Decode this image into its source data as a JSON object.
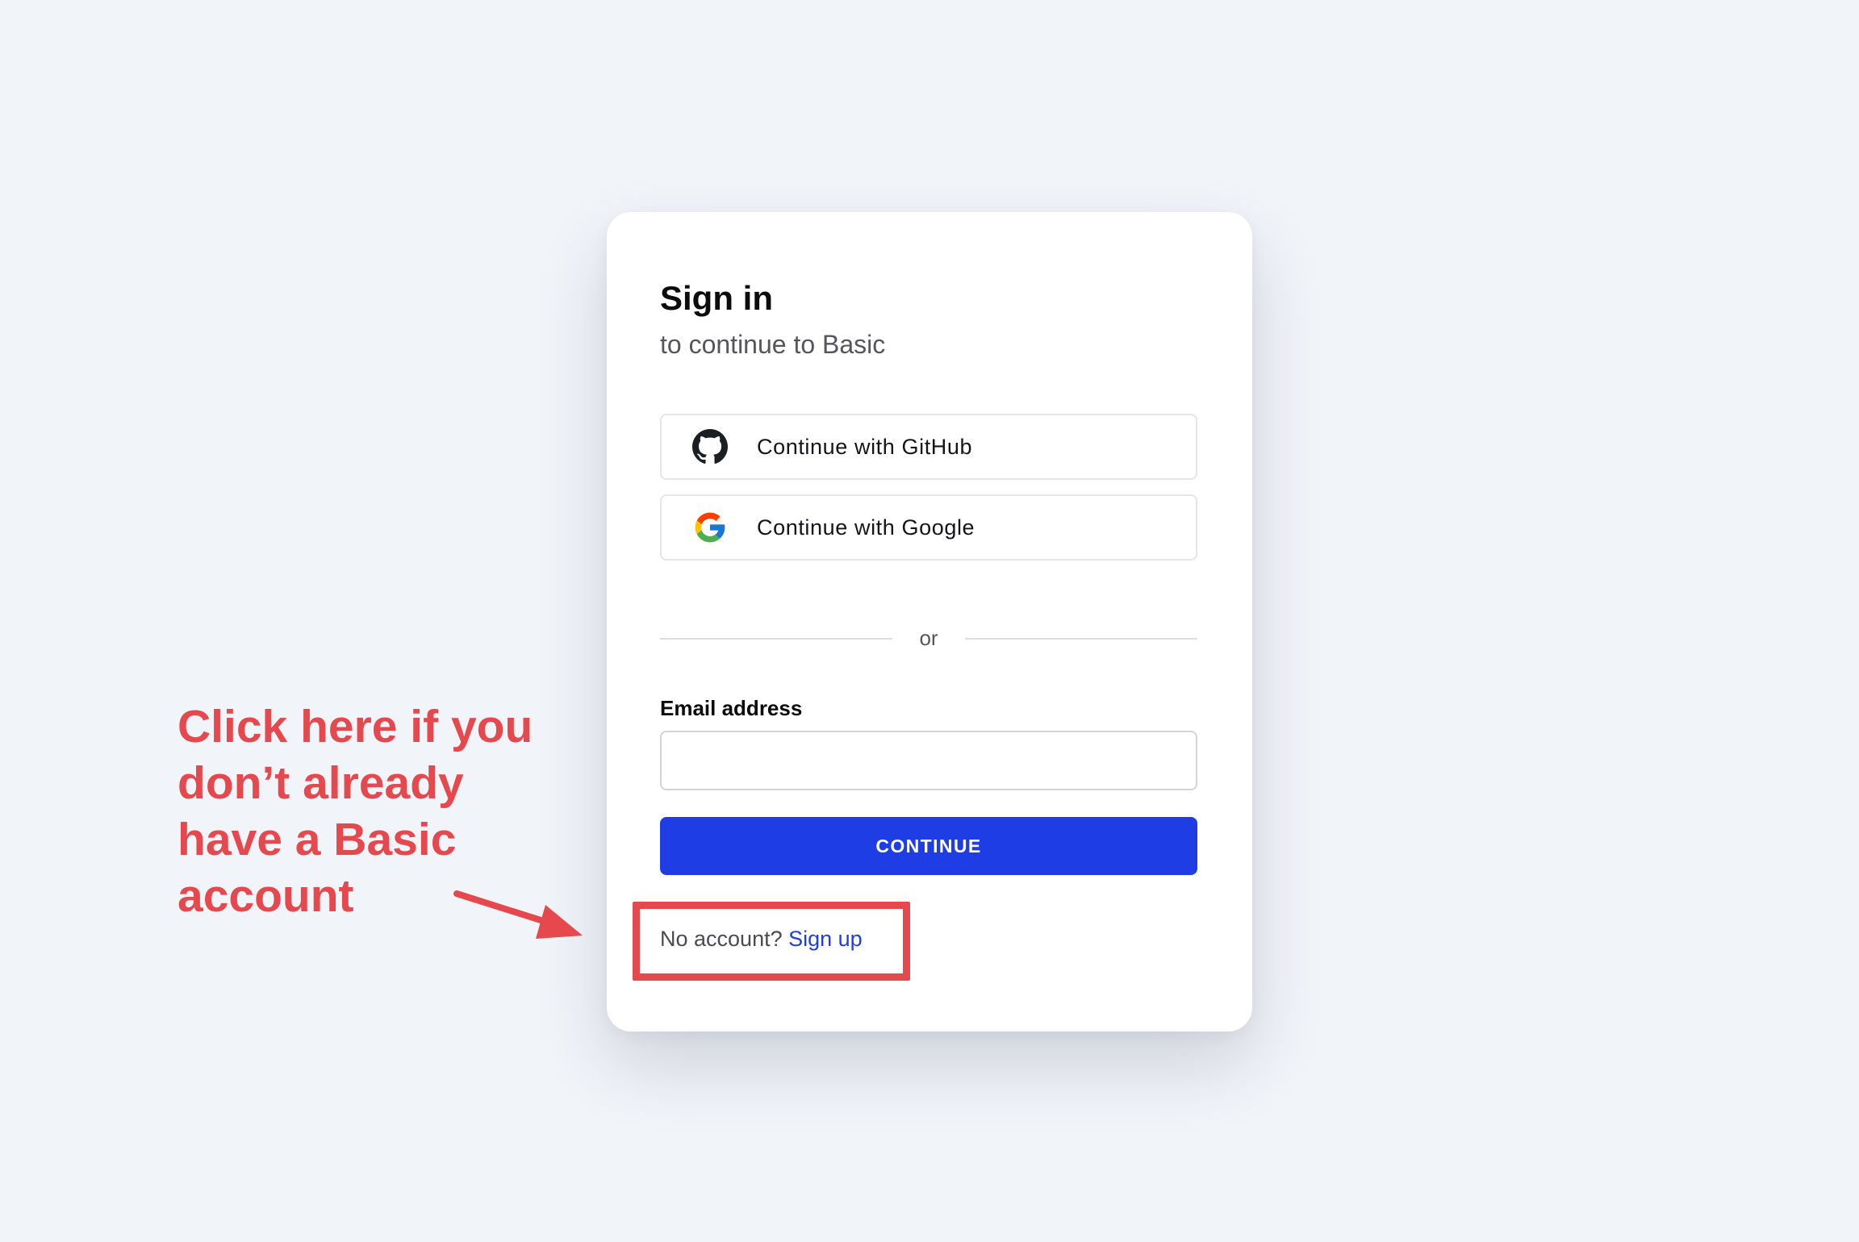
{
  "signin": {
    "title": "Sign in",
    "subtitle": "to continue to Basic",
    "github_label": "Continue with GitHub",
    "google_label": "Continue with Google",
    "divider_text": "or",
    "email_label": "Email address",
    "email_value": "",
    "continue_label": "CONTINUE",
    "no_account_text": "No account?",
    "signup_link": "Sign up"
  },
  "annotation": {
    "text": "Click here if you don’t already have a Basic account"
  },
  "icons": {
    "github": "github-icon",
    "google": "google-icon",
    "arrow": "arrow-icon"
  },
  "colors": {
    "background": "#f1f4f9",
    "card": "#ffffff",
    "primary": "#1e3de5",
    "annotation": "#e5484d",
    "text": "#0c0c0f",
    "muted_text": "#55565c"
  }
}
